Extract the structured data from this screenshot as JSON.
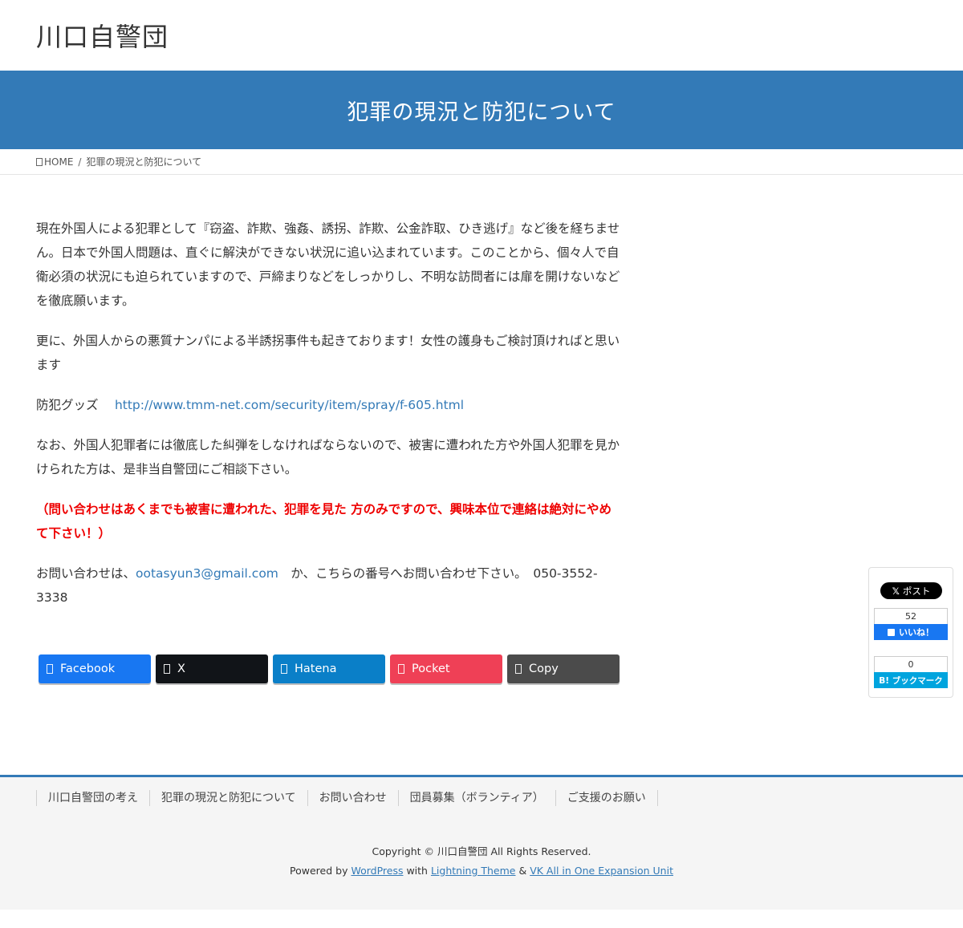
{
  "site": {
    "title": "川口自警団"
  },
  "page": {
    "title": "犯罪の現況と防犯について"
  },
  "breadcrumb": {
    "home": "HOME",
    "separator": "/",
    "current": "犯罪の現況と防犯について"
  },
  "content": {
    "p1": "現在外国人による犯罪として『窃盗、詐欺、強姦、誘拐、詐欺、公金詐取、ひき逃げ』など後を経ちません。日本で外国人問題は、直ぐに解決ができない状況に追い込まれています。このことから、個々人で自衛必須の状況にも迫られていますので、戸締まりなどをしっかりし、不明な訪問者には扉を開けないなどを徹底願います。",
    "p2": "更に、外国人からの悪質ナンパによる半誘拐事件も起きております！女性の護身もご検討頂ければと思います",
    "goods_label": "防犯グッズ　",
    "goods_link": "http://www.tmm-net.com/security/item/spray/f-605.html",
    "p4": "なお、外国人犯罪者には徹底した糾弾をしなければならないので、被害に遭われた方や外国人犯罪を見かけられた方は、是非当自警団にご相談下さい。",
    "warning": "（問い合わせはあくまでも被害に遭われた、犯罪を見た 方のみですので、興味本位で連絡は絶対にやめて下さい！）",
    "contact_prefix": "お問い合わせは、",
    "contact_email": "ootasyun3@gmail.com",
    "contact_suffix": "　か、こちらの番号へお問い合わせ下さい。　050-3552-3338"
  },
  "share": {
    "facebook": "Facebook",
    "x": "X",
    "hatena": "Hatena",
    "pocket": "Pocket",
    "copy": "Copy",
    "colors": {
      "facebook": "#1877f2",
      "x": "#111418",
      "hatena": "#0a7fc8",
      "pocket": "#ef4056",
      "copy": "#4b4b4b"
    }
  },
  "side": {
    "x_post": "ポスト",
    "x_mark": "𝕏",
    "fb_count": "52",
    "fb_like": "いいね！",
    "hb_count": "0",
    "hb_label": "B! ブックマーク"
  },
  "footer": {
    "nav": [
      "川口自警団の考え",
      "犯罪の現況と防犯について",
      "お問い合わせ",
      "団員募集（ボランティア）",
      "ご支援のお願い"
    ],
    "copyright": "Copyright © 川口自警団 All Rights Reserved.",
    "powered_prefix": "Powered by ",
    "wordpress": "WordPress",
    "with": " with ",
    "lightning": "Lightning Theme",
    "amp": " & ",
    "vk": "VK All in One Expansion Unit"
  },
  "colors": {
    "accent": "#337ab7",
    "warning": "#ee0000"
  }
}
